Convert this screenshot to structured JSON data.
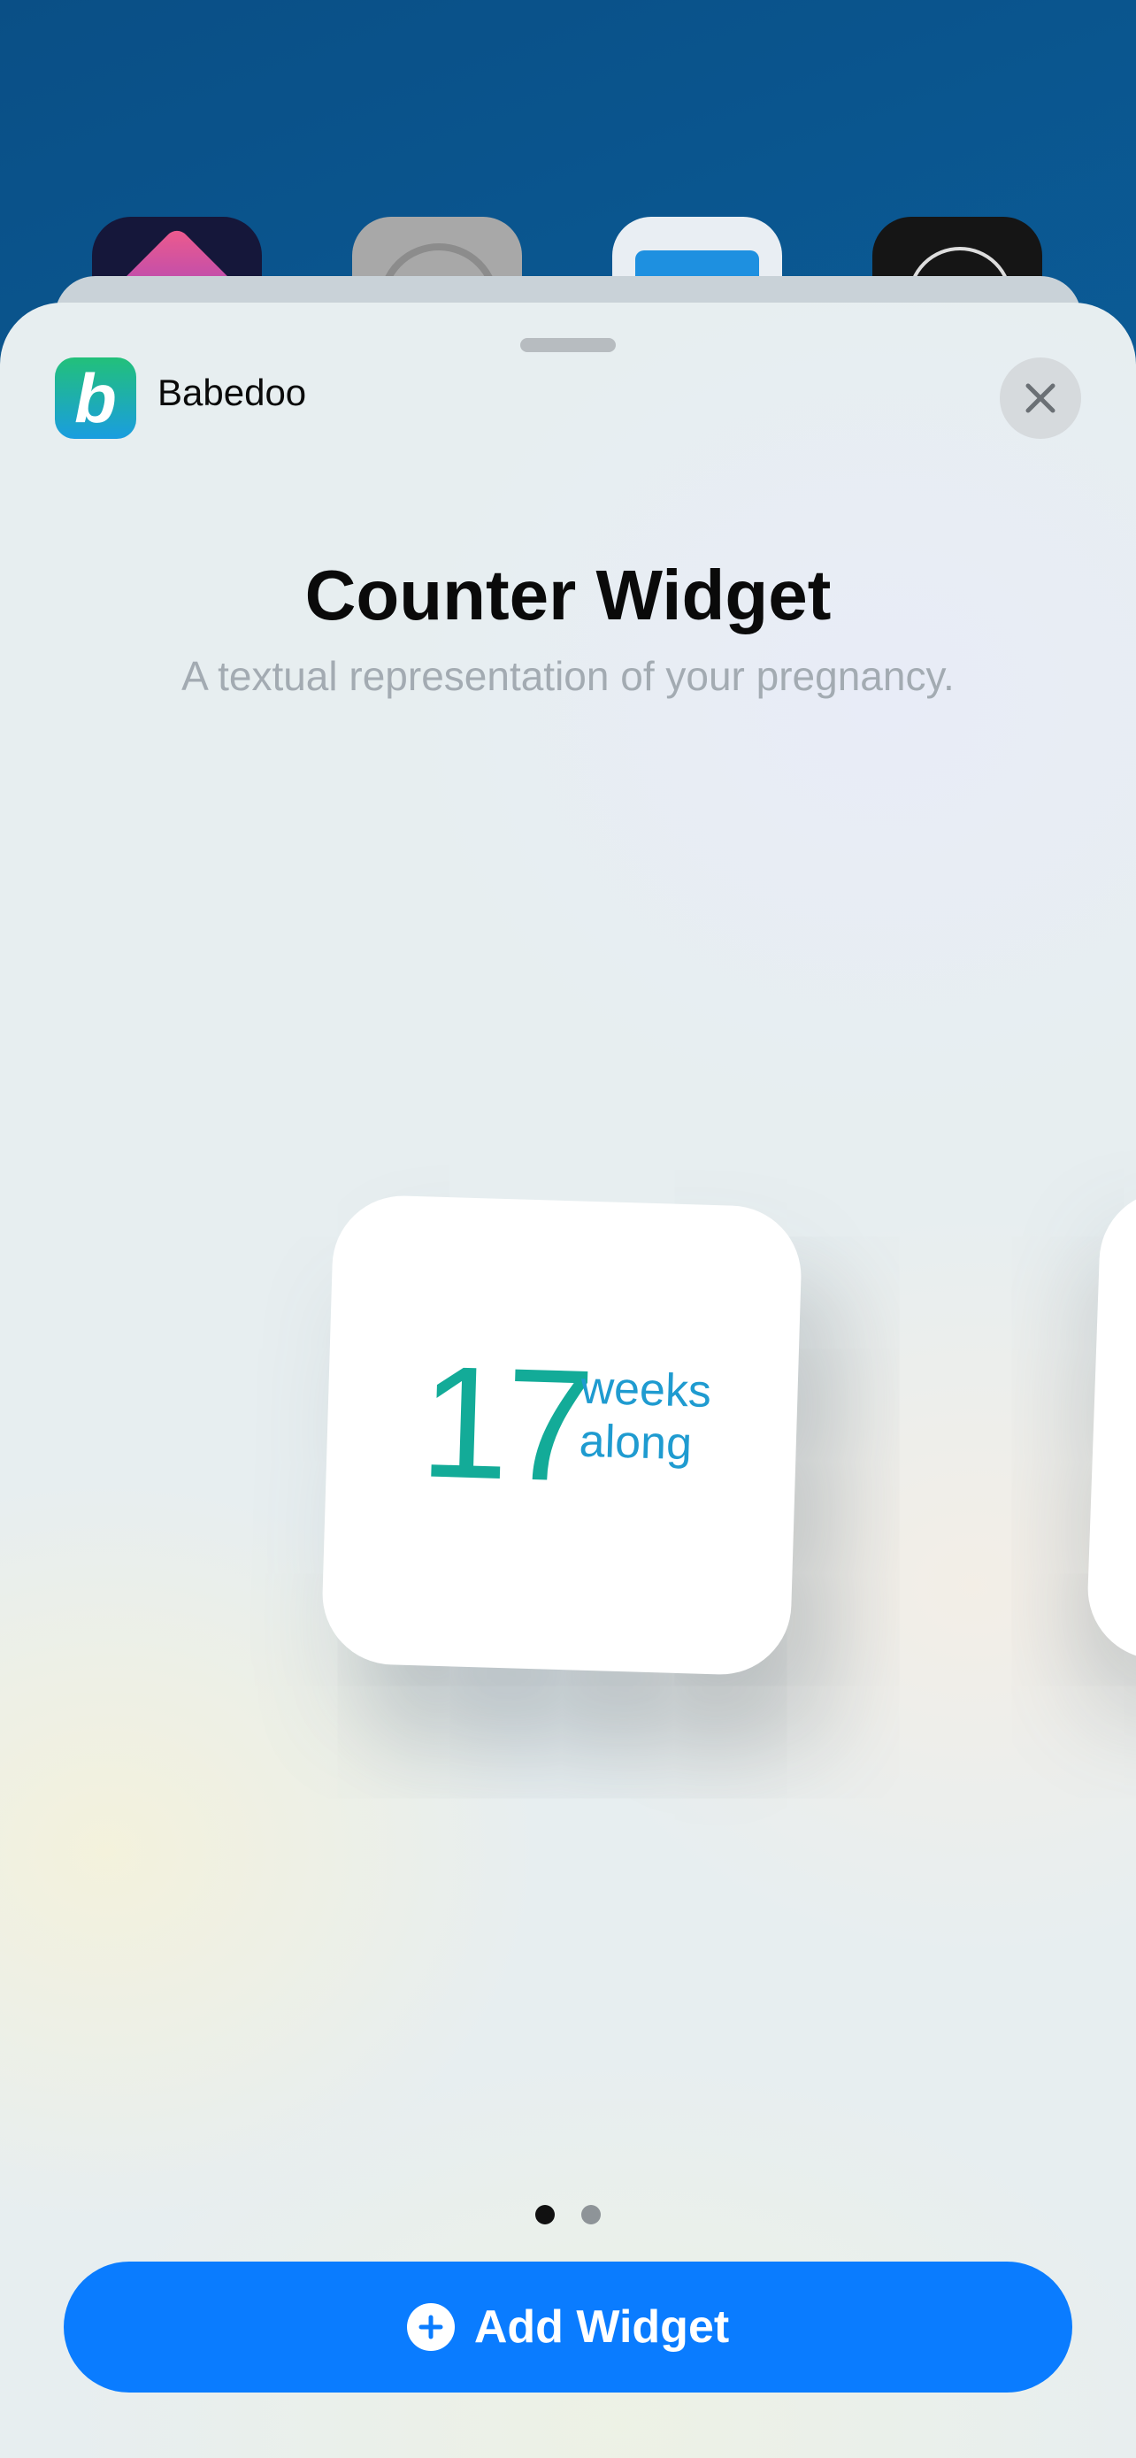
{
  "app": {
    "name": "Babedoo",
    "icon_letter": "b"
  },
  "widget_gallery": {
    "title": "Counter Widget",
    "description": "A textual representation of your pregnancy.",
    "preview": {
      "count": "17",
      "unit_line1": "weeks",
      "unit_line2": "along"
    },
    "page_count": 2,
    "current_page": 1
  },
  "actions": {
    "add_label": "Add Widget"
  },
  "colors": {
    "accent": "#0a7cff",
    "counter_number": "#13ab98",
    "counter_unit": "#1f9bd0"
  }
}
